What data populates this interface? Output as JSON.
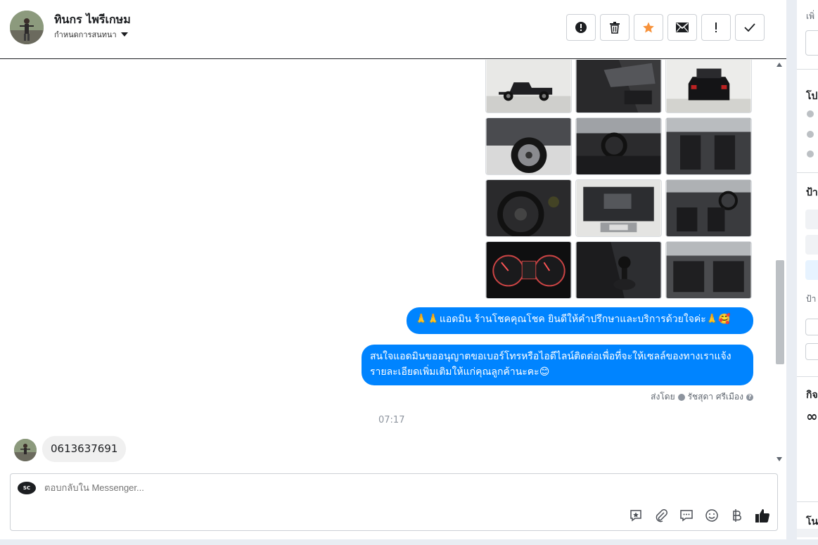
{
  "header": {
    "contact_name": "ทินกร ไพรีเกษม",
    "assign_label": "กำหนดการสนทนา",
    "actions": [
      {
        "name": "spam-button",
        "icon": "alert-circle-icon"
      },
      {
        "name": "delete-button",
        "icon": "trash-icon"
      },
      {
        "name": "star-button",
        "icon": "star-icon"
      },
      {
        "name": "mark-unread-button",
        "icon": "envelope-icon"
      },
      {
        "name": "follow-up-button",
        "icon": "exclamation-icon"
      },
      {
        "name": "mark-done-button",
        "icon": "checkmark-icon"
      }
    ],
    "star_color": "#f7923b"
  },
  "messages": {
    "outgoing_1": "🙏🙏แอดมิน ร้านโชคคุณโชค ยินดีให้คำปรึกษาและบริการด้วยใจค่ะ🙏🥰",
    "outgoing_2": "สนใจแอดมินขออนุญาตขอเบอร์โทรหรือไอดีไลน์ติดต่อเพื่อที่จะให้เซลล์ของทางเราแจ้งรายละเอียดเพิ่มเติมให้แก่คุณลูกค้านะคะ😊",
    "sent_by_prefix": "ส่งโดย",
    "sent_by_name": "รัชสุดา ศรีเมือง",
    "timestamp": "07:17",
    "incoming_1": "0613637691",
    "bubble_color": "#0084ff"
  },
  "photos": [
    "truck-side",
    "door-interior",
    "truck-rear",
    "wheel",
    "dashboard",
    "front-seats",
    "steering-wheel",
    "engine-bay",
    "interior-wide",
    "gauge-cluster",
    "gear-shifter",
    "rear-seats"
  ],
  "composer": {
    "placeholder": "ตอบกลับใน Messenger...",
    "page_logo_text": "SC",
    "tools": [
      "saved-reply-icon",
      "attach-icon",
      "chat-bubble-icon",
      "emoji-icon",
      "baht-icon",
      "like-icon"
    ]
  },
  "sidebar": {
    "label_1": "เพิ่",
    "label_2": "โป",
    "label_3": "ป้า",
    "label_4": "ป้า",
    "label_5": "กิจ",
    "label_6": "โน",
    "meta_glyph": "∞"
  }
}
